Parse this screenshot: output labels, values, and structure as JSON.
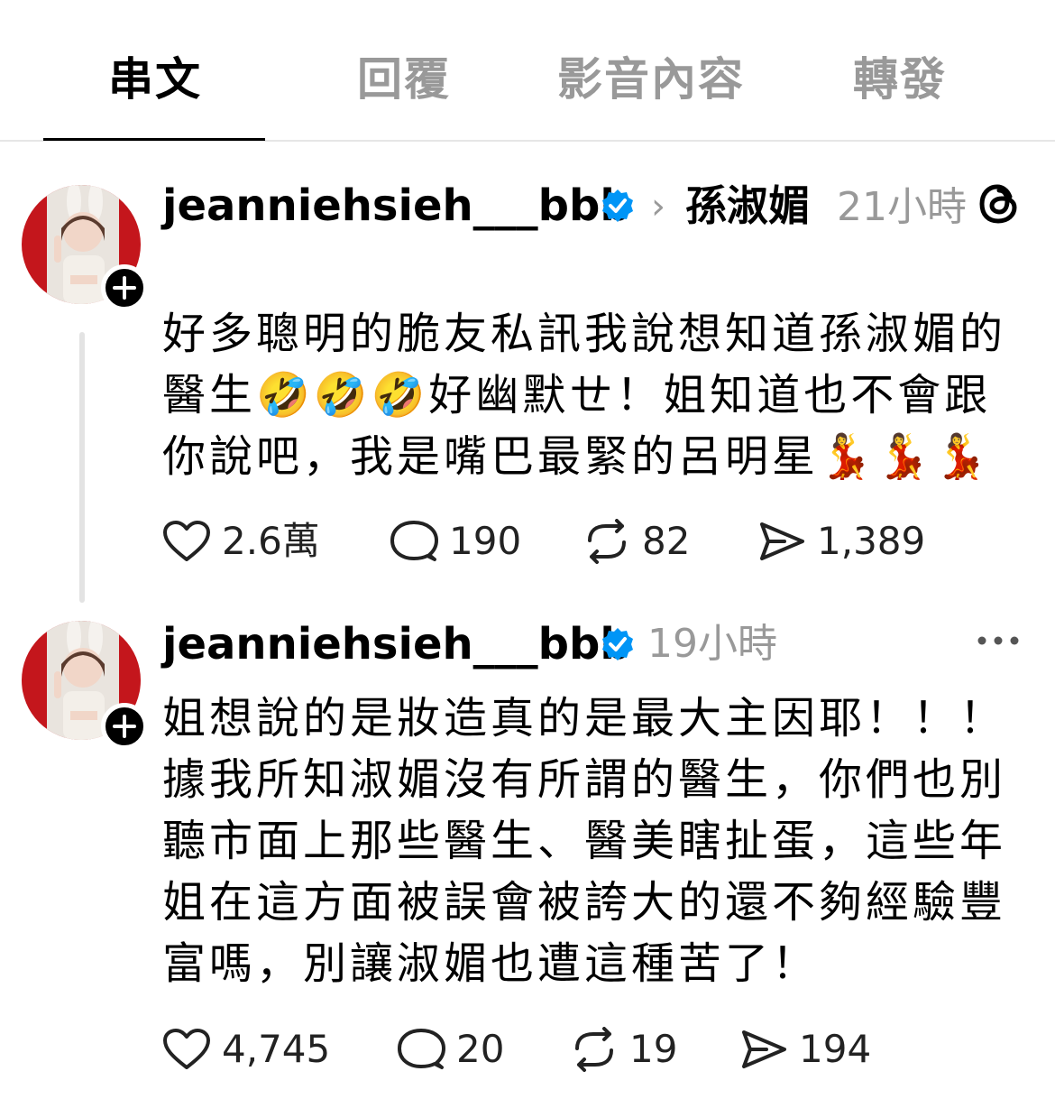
{
  "tabs": [
    {
      "label": "串文",
      "active": true
    },
    {
      "label": "回覆",
      "active": false
    },
    {
      "label": "影音內容",
      "active": false
    },
    {
      "label": "轉發",
      "active": false
    }
  ],
  "posts": [
    {
      "username": "jeanniehsieh___bbb",
      "verified": true,
      "reply_to": "孫淑媚",
      "time": "21小時",
      "content": "好多聰明的脆友私訊我說想知道孫淑媚的醫生🤣🤣🤣好幽默ㄝ！姐知道也不會跟你說吧，我是嘴巴最緊的呂明星💃💃💃",
      "likes": "2.6萬",
      "comments": "190",
      "reposts": "82",
      "shares": "1,389"
    },
    {
      "username": "jeanniehsieh___bbb",
      "verified": true,
      "time": "19小時",
      "content": "姐想說的是妝造真的是最大主因耶！！！據我所知淑媚沒有所謂的醫生，你們也別聽市面上那些醫生、醫美瞎扯蛋，這些年姐在這方面被誤會被誇大的還不夠經驗豐富嗎，別讓淑媚也遭這種苦了！",
      "likes": "4,745",
      "comments": "20",
      "reposts": "19",
      "shares": "194"
    }
  ],
  "colors": {
    "verified": "#0095f6",
    "muted": "#999999",
    "avatar_bg": "#c4161c"
  },
  "icons": [
    "threads-logo-icon",
    "verified-badge-icon",
    "heart-icon",
    "comment-icon",
    "repost-icon",
    "share-icon",
    "more-icon",
    "plus-icon"
  ]
}
